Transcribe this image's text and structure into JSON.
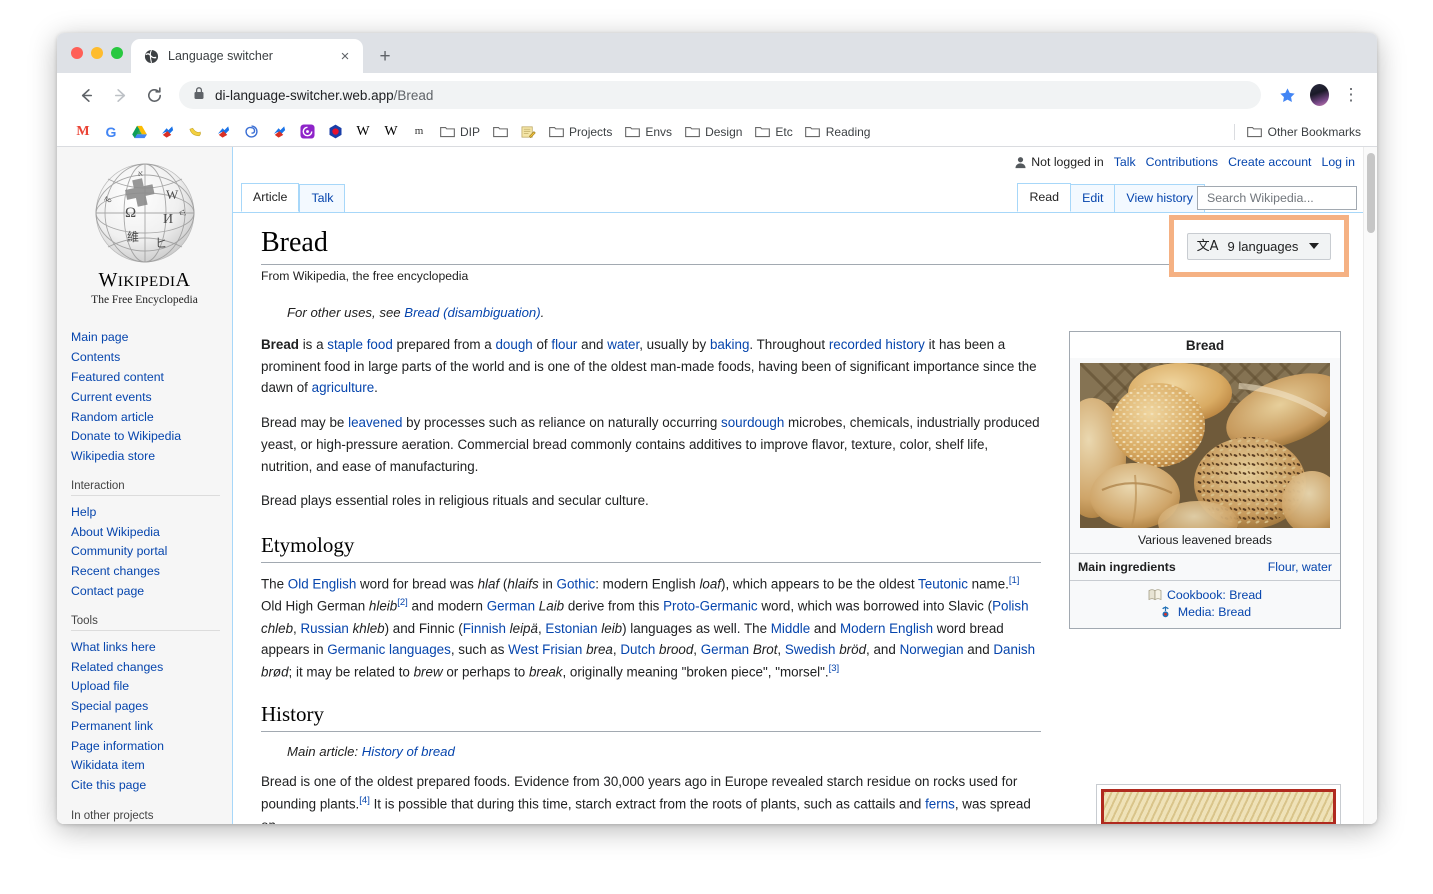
{
  "browser": {
    "tab": {
      "title": "Language switcher",
      "favicon": "globe-icon",
      "close": "×"
    },
    "new_tab_label": "+",
    "nav": {
      "back": "←",
      "forward": "→",
      "reload": "↻"
    },
    "omnibox": {
      "lock": "lock-icon",
      "host": "di-language-switcher.web.app",
      "path": "/Bread"
    },
    "star": "★",
    "menu": "⋮",
    "bookmarks": [
      {
        "icon": "gmail-icon",
        "label": ""
      },
      {
        "icon": "google-icon",
        "label": ""
      },
      {
        "icon": "drive-icon",
        "label": ""
      },
      {
        "icon": "dino-icon",
        "label": ""
      },
      {
        "icon": "banana-icon",
        "label": ""
      },
      {
        "icon": "dino-icon",
        "label": ""
      },
      {
        "icon": "spiral-icon",
        "label": ""
      },
      {
        "icon": "dino-icon",
        "label": ""
      },
      {
        "icon": "purple-app-icon",
        "label": ""
      },
      {
        "icon": "red-hex-icon",
        "label": ""
      },
      {
        "icon": "wikipedia-w-icon",
        "label": ""
      },
      {
        "icon": "wikipedia-w-icon",
        "label": ""
      },
      {
        "icon": "m-icon",
        "label": ""
      },
      {
        "icon": "folder-icon",
        "label": "DIP"
      },
      {
        "icon": "folder-icon",
        "label": ""
      },
      {
        "icon": "memo-icon",
        "label": ""
      },
      {
        "icon": "folder-icon",
        "label": "Projects"
      },
      {
        "icon": "folder-icon",
        "label": "Envs"
      },
      {
        "icon": "folder-icon",
        "label": "Design"
      },
      {
        "icon": "folder-icon",
        "label": "Etc"
      },
      {
        "icon": "folder-icon",
        "label": "Reading"
      }
    ],
    "other_bookmarks": {
      "icon": "folder-icon",
      "label": "Other Bookmarks"
    }
  },
  "wikipedia": {
    "logo": {
      "wordmark_w": "W",
      "wordmark_rest": "IKIPEDI",
      "wordmark_a": "A",
      "tagline": "The Free Encyclopedia"
    },
    "userlinks": [
      {
        "label": "Not logged in",
        "type": "plain",
        "icon": "user-icon"
      },
      {
        "label": "Talk",
        "type": "link"
      },
      {
        "label": "Contributions",
        "type": "link"
      },
      {
        "label": "Create account",
        "type": "link"
      },
      {
        "label": "Log in",
        "type": "link"
      }
    ],
    "namespace_tabs": [
      {
        "label": "Article",
        "selected": true
      },
      {
        "label": "Talk",
        "selected": false
      }
    ],
    "view_tabs": [
      {
        "label": "Read",
        "selected": true
      },
      {
        "label": "Edit",
        "selected": false
      },
      {
        "label": "View history",
        "selected": false
      }
    ],
    "search": {
      "placeholder": "Search Wikipedia...",
      "value": ""
    },
    "language_switcher": {
      "icon": "文A",
      "label": "9 languages",
      "caret": "caret-down-icon",
      "highlight_color": "#f5b183"
    },
    "sidebar": {
      "portal_items": [
        "Main page",
        "Contents",
        "Featured content",
        "Current events",
        "Random article",
        "Donate to Wikipedia",
        "Wikipedia store"
      ],
      "sections": [
        {
          "heading": "Interaction",
          "items": [
            "Help",
            "About Wikipedia",
            "Community portal",
            "Recent changes",
            "Contact page"
          ]
        },
        {
          "heading": "Tools",
          "items": [
            "What links here",
            "Related changes",
            "Upload file",
            "Special pages",
            "Permanent link",
            "Page information",
            "Wikidata item",
            "Cite this page"
          ]
        },
        {
          "heading": "In other projects",
          "items": []
        }
      ]
    },
    "article": {
      "title": "Bread",
      "site_sub": "From Wikipedia, the free encyclopedia",
      "hatnote_prefix": "For other uses, see ",
      "hatnote_link": "Bread (disambiguation)",
      "hatnote_suffix": ".",
      "lead_p1": {
        "bold": "Bread",
        "t1": " is a ",
        "l1": "staple food",
        "t2": " prepared from a ",
        "l2": "dough",
        "t3": " of ",
        "l3": "flour",
        "t4": " and ",
        "l4": "water",
        "t5": ", usually by ",
        "l5": "baking",
        "t6": ". Throughout ",
        "l6": "recorded history",
        "t7": " it has been a prominent food in large parts of the world and is one of the oldest man-made foods, having been of significant importance since the dawn of ",
        "l7": "agriculture",
        "t8": "."
      },
      "lead_p2": {
        "t1": "Bread may be ",
        "l1": "leavened",
        "t2": " by processes such as reliance on naturally occurring ",
        "l2": "sourdough",
        "t3": " microbes, chemicals, industrially produced yeast, or high-pressure aeration. Commercial bread commonly contains additives to improve flavor, texture, color, shelf life, nutrition, and ease of manufacturing."
      },
      "lead_p3": "Bread plays essential roles in religious rituals and secular culture.",
      "etymology_heading": "Etymology",
      "etymology": {
        "t1": "The ",
        "l1": "Old English",
        "t2": " word for bread was ",
        "i1": "hlaf",
        "t3": " (",
        "i2": "hlaifs",
        "t4": " in ",
        "l2": "Gothic",
        "t5": ": modern English ",
        "i3": "loaf",
        "t6": "), which appears to be the oldest ",
        "l3": "Teutonic",
        "t7": " name.",
        "ref1": "[1]",
        "t8": " Old High German ",
        "i4": "hleib",
        "ref2": "[2]",
        "t9": " and modern ",
        "l4": "German",
        "t10": " ",
        "i5": "Laib",
        "t11": " derive from this ",
        "l5": "Proto-Germanic",
        "t12": " word, which was borrowed into Slavic (",
        "l6": "Polish",
        "t13": " ",
        "i6": "chleb",
        "t14": ", ",
        "l7": "Russian",
        "t15": " ",
        "i7": "khleb",
        "t16": ") and Finnic (",
        "l8": "Finnish",
        "t17": " ",
        "i8": "leipä",
        "t18": ", ",
        "l9": "Estonian",
        "t19": " ",
        "i9": "leib",
        "t20": ") languages as well. The ",
        "l10": "Middle",
        "t21": " and ",
        "l11": "Modern English",
        "t22": " word bread appears in ",
        "l12": "Germanic languages",
        "t23": ", such as ",
        "l13": "West Frisian",
        "t24": " ",
        "i10": "brea",
        "t25": ", ",
        "l14": "Dutch",
        "t26": " ",
        "i11": "brood",
        "t27": ", ",
        "l15": "German",
        "t28": " ",
        "i12": "Brot",
        "t29": ", ",
        "l16": "Swedish",
        "t30": " ",
        "i13": "bröd",
        "t31": ", and ",
        "l17": "Norwegian",
        "t32": " and ",
        "l18": "Danish",
        "t33": " ",
        "i14": "brød",
        "t34": "; it may be related to ",
        "i15": "brew",
        "t35": " or perhaps to ",
        "i16": "break",
        "t36": ", originally meaning \"broken piece\", \"morsel\".",
        "ref3": "[3]"
      },
      "history_heading": "History",
      "history_hatnote_prefix": "Main article: ",
      "history_hatnote_link": "History of bread",
      "history_p1": {
        "t1": "Bread is one of the oldest prepared foods. Evidence from 30,000 years ago in Europe revealed starch residue on rocks used for pounding plants.",
        "ref4": "[4]",
        "t2": " It is possible that during this time, starch extract from the roots of plants, such as cattails and ",
        "l1": "ferns",
        "t3": ", was spread on"
      },
      "infobox": {
        "title": "Bread",
        "caption": "Various leavened breads",
        "row_label": "Main ingredients",
        "row_value": "Flour, water",
        "links": [
          {
            "icon": "cookbook-icon",
            "label": "Cookbook: Bread"
          },
          {
            "icon": "commons-icon",
            "label": "Media: Bread"
          }
        ]
      }
    }
  }
}
